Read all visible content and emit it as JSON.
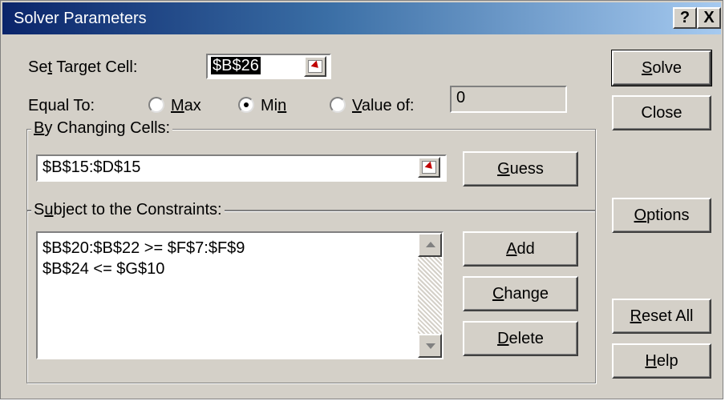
{
  "window": {
    "title": "Solver Parameters",
    "help_button": "?",
    "close_button": "X"
  },
  "target": {
    "label_prefix": "Se",
    "label_accel": "t",
    "label_suffix": " Target Cell:",
    "value": "$B$26"
  },
  "equal_to": {
    "label": "Equal To:",
    "options": [
      {
        "accel": "M",
        "rest": "ax",
        "selected": false
      },
      {
        "pre": "Mi",
        "accel": "n",
        "selected": true
      },
      {
        "accel": "V",
        "rest": "alue of:",
        "selected": false
      }
    ],
    "value_of": "0"
  },
  "changing": {
    "label_accel": "B",
    "label_rest": "y Changing Cells:",
    "value": "$B$15:$D$15",
    "guess_accel": "G",
    "guess_rest": "uess"
  },
  "constraints": {
    "label_pre": "S",
    "label_accel": "u",
    "label_rest": "bject to the Constraints:",
    "items": [
      "$B$20:$B$22 >= $F$7:$F$9",
      "$B$24 <= $G$10"
    ],
    "add_accel": "A",
    "add_rest": "dd",
    "change_accel": "C",
    "change_rest": "hange",
    "delete_accel": "D",
    "delete_rest": "elete"
  },
  "side_buttons": {
    "solve_accel": "S",
    "solve_rest": "olve",
    "close": "Close",
    "options_accel": "O",
    "options_rest": "ptions",
    "reset_accel": "R",
    "reset_rest": "eset All",
    "help_accel": "H",
    "help_rest": "elp"
  },
  "colors": {
    "title_start": "#0a246a",
    "title_end": "#a6caf0",
    "face": "#d4d0c8"
  },
  "icons": {
    "collapse": "range-select-icon",
    "scroll_up": "scroll-up-arrow-icon",
    "scroll_down": "scroll-down-arrow-icon"
  }
}
